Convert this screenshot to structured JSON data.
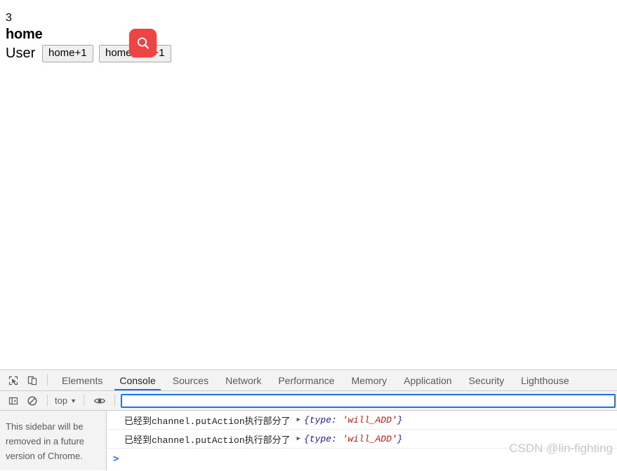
{
  "page": {
    "count": "3",
    "heading": "home",
    "user_label": "User",
    "buttons": [
      {
        "name": "home-plus-one-button",
        "label": "home+1"
      },
      {
        "name": "home-async-plus-one-button",
        "label": "home异步+1"
      }
    ],
    "badge": {
      "icon": "magnifier-icon",
      "color": "#ef4444"
    }
  },
  "devtools": {
    "toolbar_icons": [
      {
        "name": "inspect-element-icon"
      },
      {
        "name": "device-toolbar-icon"
      }
    ],
    "tabs": [
      {
        "label": "Elements",
        "active": false
      },
      {
        "label": "Console",
        "active": true
      },
      {
        "label": "Sources",
        "active": false
      },
      {
        "label": "Network",
        "active": false
      },
      {
        "label": "Performance",
        "active": false
      },
      {
        "label": "Memory",
        "active": false
      },
      {
        "label": "Application",
        "active": false
      },
      {
        "label": "Security",
        "active": false
      },
      {
        "label": "Lighthouse",
        "active": false
      }
    ],
    "active_tab": "Console",
    "accent_color": "#1a73e8",
    "console_toolbar": {
      "sidebar_toggle_icon": "console-sidebar-toggle-icon",
      "clear_icon": "clear-console-icon",
      "context_value": "top",
      "context_caret": "▼",
      "eye_icon": "live-expression-eye-icon",
      "filter_value": "",
      "filter_placeholder": ""
    },
    "sidebar": {
      "note": "This sidebar will be removed in a future version of Chrome."
    },
    "messages": [
      {
        "text": "已经到channel.putAction执行部分了",
        "toggle": "▶",
        "object_prefix": "{type: ",
        "object_value": "'will_ADD'",
        "object_suffix": "}"
      },
      {
        "text": "已经到channel.putAction执行部分了",
        "toggle": "▶",
        "object_prefix": "{type: ",
        "object_value": "'will_ADD'",
        "object_suffix": "}"
      }
    ],
    "prompt": ">"
  },
  "watermark": {
    "text": "CSDN @lin-fighting"
  }
}
